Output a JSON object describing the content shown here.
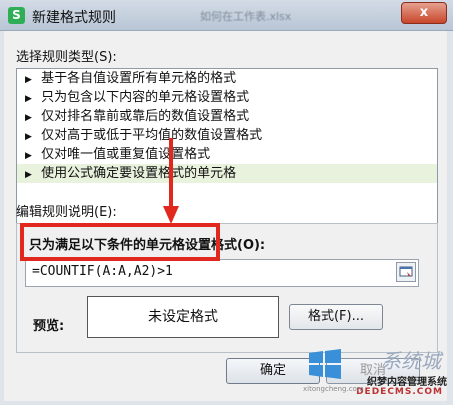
{
  "window": {
    "title": "新建格式规则",
    "app_icon": "S",
    "background_title": "如何在工作表.xlsx",
    "close_label": "x"
  },
  "rule_types": {
    "label": "选择规则类型(S):",
    "items": [
      {
        "label": "基于各自值设置所有单元格的格式",
        "selected": false
      },
      {
        "label": "只为包含以下内容的单元格设置格式",
        "selected": false
      },
      {
        "label": "仅对排名靠前或靠后的数值设置格式",
        "selected": false
      },
      {
        "label": "仅对高于或低于平均值的数值设置格式",
        "selected": false
      },
      {
        "label": "仅对唯一值或重复值设置格式",
        "selected": false
      },
      {
        "label": "使用公式确定要设置格式的单元格",
        "selected": true
      }
    ]
  },
  "edit_rule": {
    "label": "编辑规则说明(E):",
    "condition_label": "只为满足以下条件的单元格设置格式(O):",
    "formula_value": "=COUNTIF(A:A,A2)>1",
    "preview_label": "预览:",
    "preview_text": "未设定格式",
    "format_button": "格式(F)..."
  },
  "buttons": {
    "ok": "确定",
    "cancel": "取消"
  },
  "watermark": {
    "line1": "系统城",
    "line2": "织梦内容管理系统",
    "line3": "DEDECMS.COM",
    "line4": "xitongcheng.com"
  },
  "colors": {
    "highlight": "#e0281e",
    "selected_row": "#e8f2dd",
    "app_icon": "#2fae55"
  }
}
